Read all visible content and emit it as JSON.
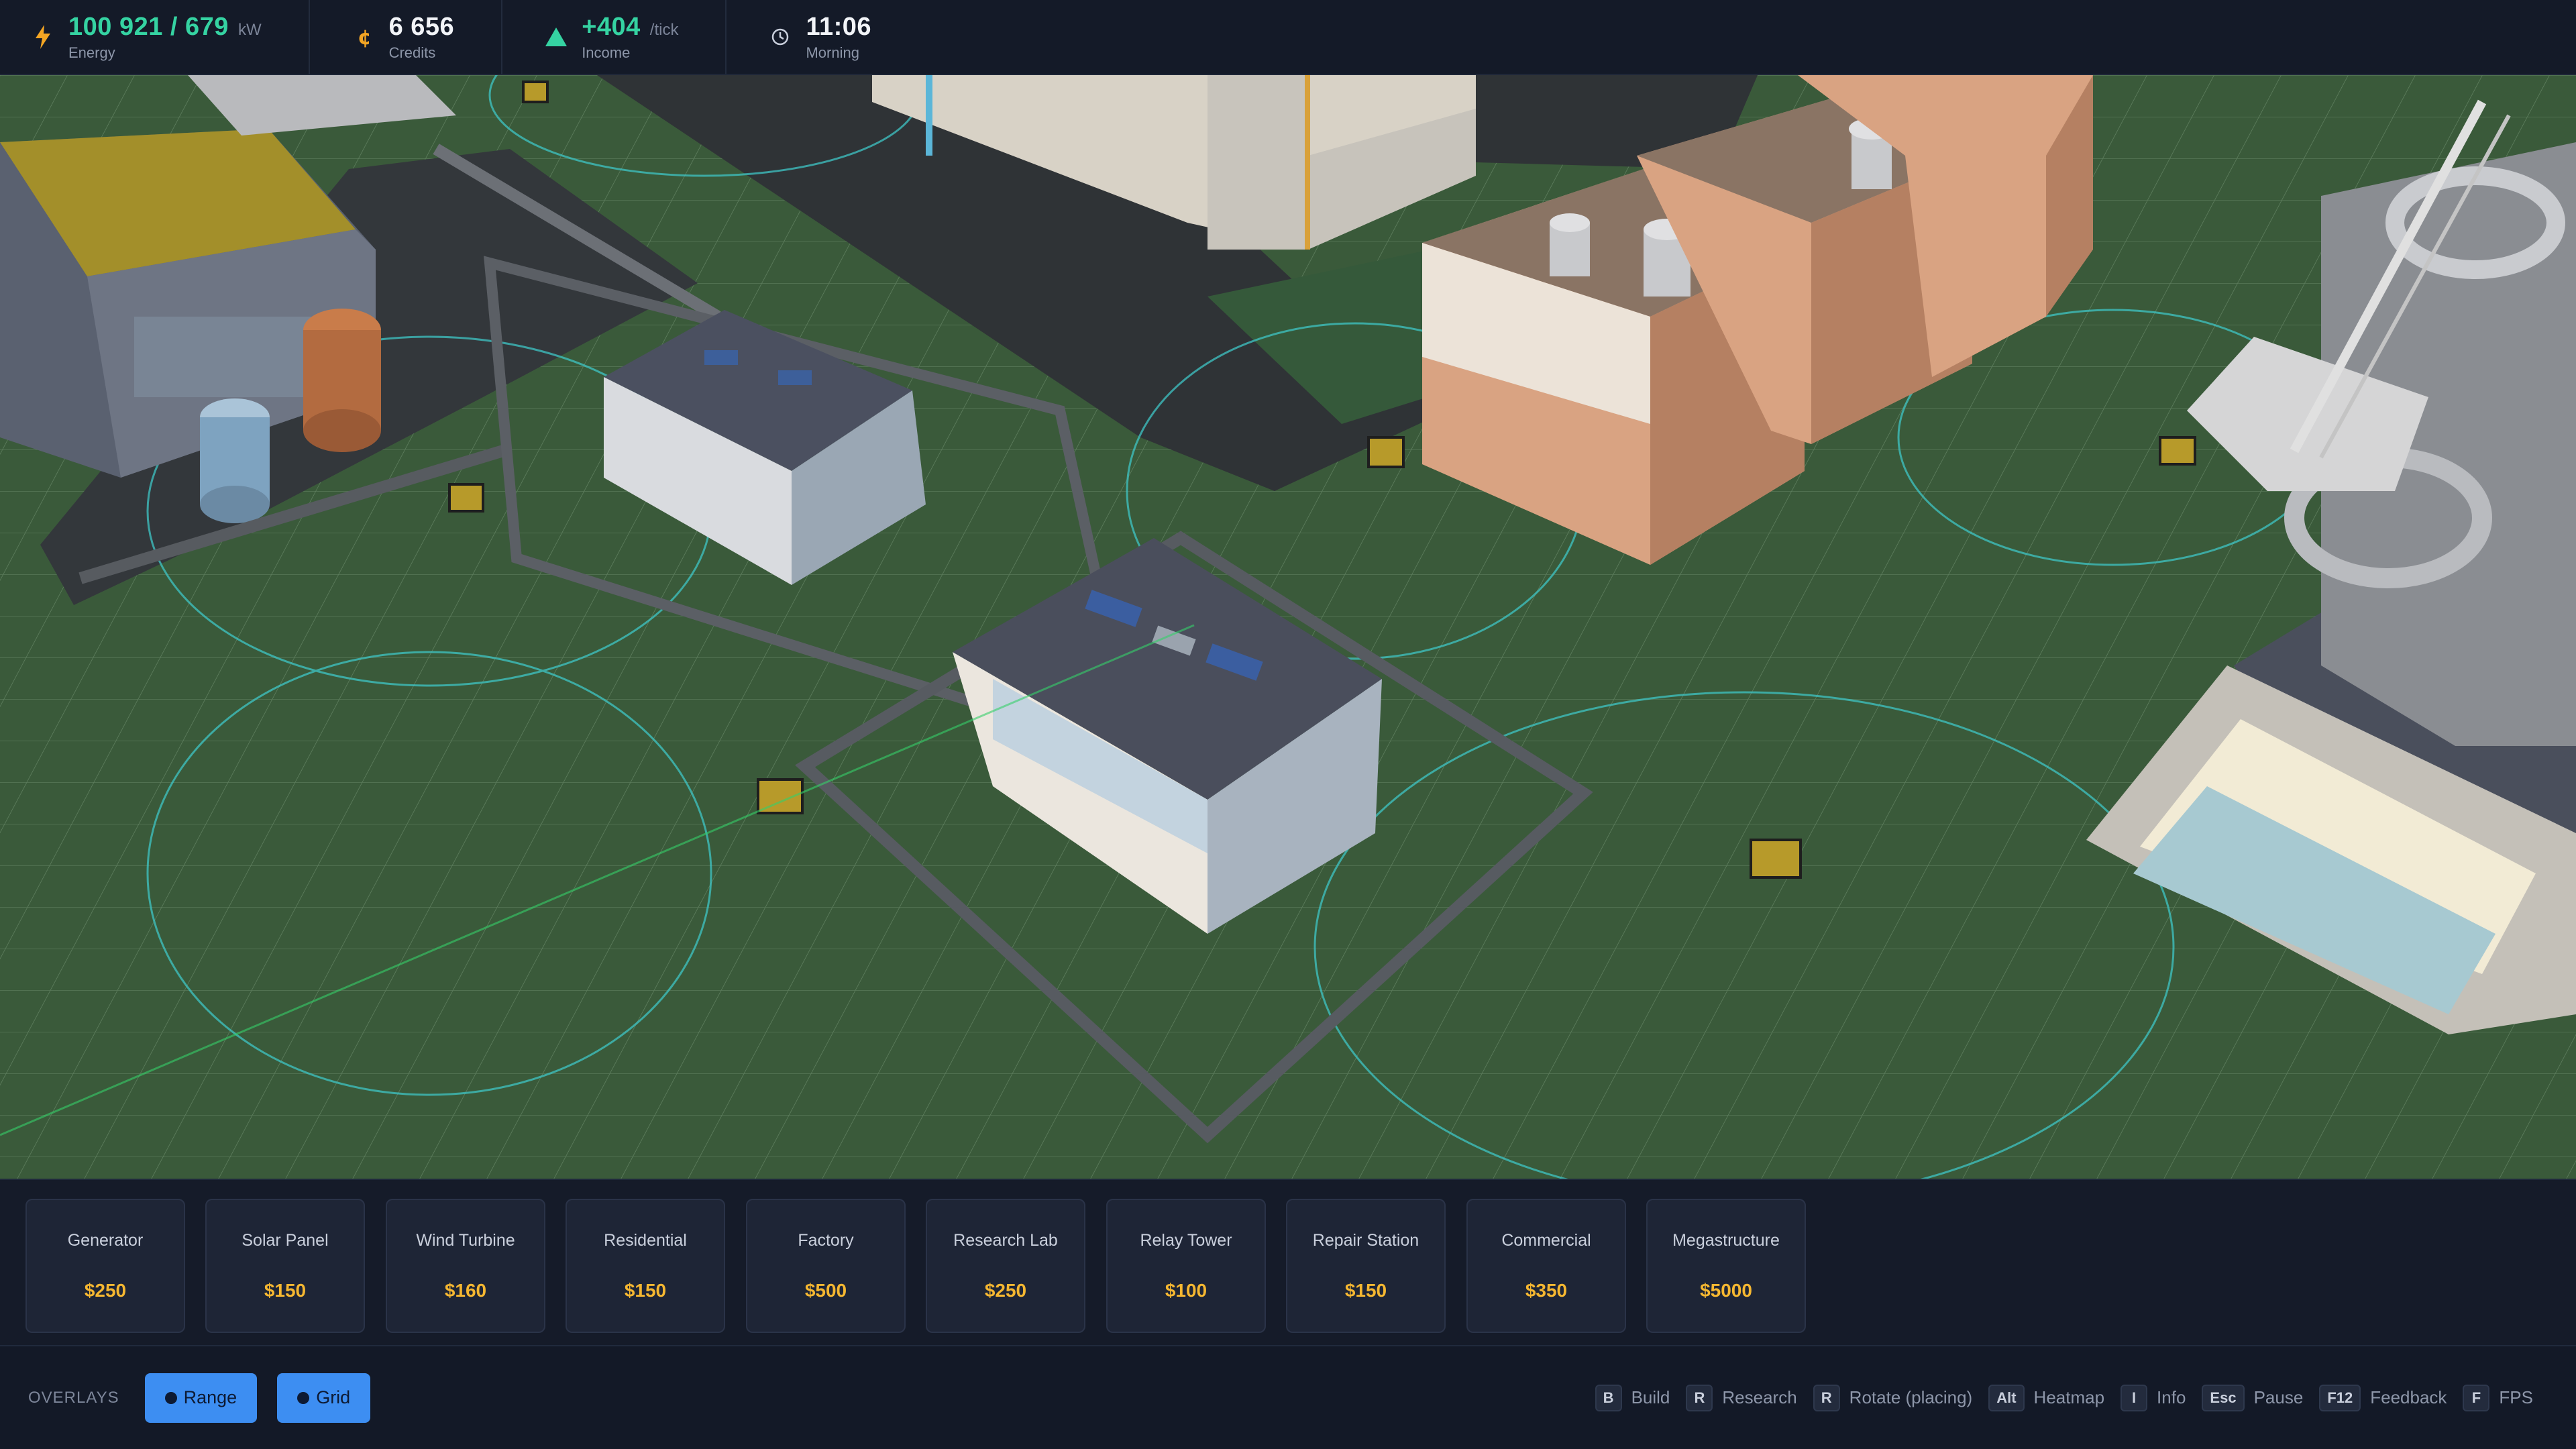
{
  "hud": {
    "energy": {
      "value": "100 921 / 679",
      "unit": "kW",
      "label": "Energy",
      "icon": "lightning-icon",
      "color": "#35d3a2"
    },
    "credits": {
      "value": "6 656",
      "label": "Credits",
      "icon": "coin-icon",
      "color": "#f2f4f8"
    },
    "income": {
      "value": "+404",
      "unit": "/tick",
      "label": "Income",
      "icon": "triangle-up-icon",
      "color": "#35d3a2"
    },
    "time": {
      "value": "11:06",
      "label": "Morning",
      "icon": "clock-icon",
      "color": "#f2f4f8"
    }
  },
  "build": {
    "items": [
      {
        "name": "Generator",
        "price": "$250"
      },
      {
        "name": "Solar Panel",
        "price": "$150"
      },
      {
        "name": "Wind Turbine",
        "price": "$160"
      },
      {
        "name": "Residential",
        "price": "$150"
      },
      {
        "name": "Factory",
        "price": "$500"
      },
      {
        "name": "Research Lab",
        "price": "$250"
      },
      {
        "name": "Relay Tower",
        "price": "$100"
      },
      {
        "name": "Repair Station",
        "price": "$150"
      },
      {
        "name": "Commercial",
        "price": "$350"
      },
      {
        "name": "Megastructure",
        "price": "$5000"
      }
    ]
  },
  "overlays": {
    "label": "OVERLAYS",
    "buttons": [
      {
        "label": "Range",
        "active": true
      },
      {
        "label": "Grid",
        "active": true
      }
    ]
  },
  "shortcuts": [
    {
      "key": "B",
      "label": "Build"
    },
    {
      "key": "R",
      "label": "Research"
    },
    {
      "key": "R",
      "label": "Rotate (placing)"
    },
    {
      "key": "Alt",
      "label": "Heatmap"
    },
    {
      "key": "I",
      "label": "Info"
    },
    {
      "key": "Esc",
      "label": "Pause"
    },
    {
      "key": "F12",
      "label": "Feedback"
    },
    {
      "key": "F",
      "label": "FPS"
    }
  ],
  "colors": {
    "ground": "#3a5a3a",
    "accent": "#3d8ef2",
    "price": "#f5b731",
    "range_ring": "#3fc6c6"
  }
}
